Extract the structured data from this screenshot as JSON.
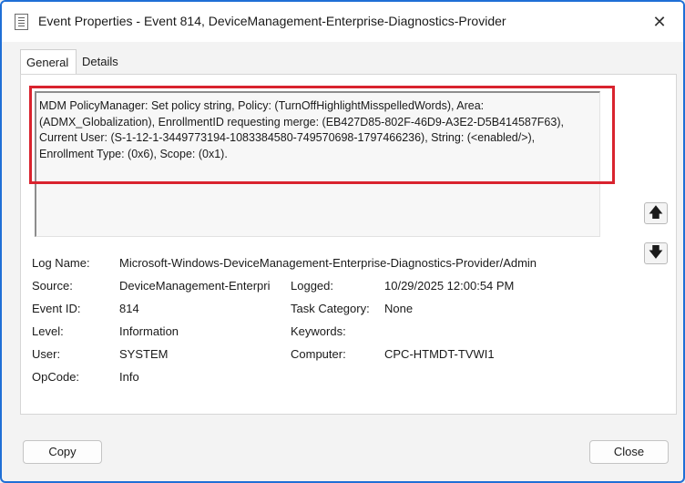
{
  "window": {
    "title": "Event Properties - Event 814, DeviceManagement-Enterprise-Diagnostics-Provider",
    "icon": "event-log-icon",
    "close_glyph": "✕"
  },
  "tabs": [
    {
      "label": "General",
      "active": true
    },
    {
      "label": "Details",
      "active": false
    }
  ],
  "message": "MDM PolicyManager: Set policy string, Policy: (TurnOffHighlightMisspelledWords), Area: (ADMX_Globalization), EnrollmentID requesting merge: (EB427D85-802F-46D9-A3E2-D5B414587F63), Current User: (S-1-12-1-3449773194-1083384580-749570698-1797466236), String: (<enabled/>), Enrollment Type: (0x6), Scope: (0x1).",
  "highlight_color": "#d9232e",
  "scroll": {
    "up_glyph": "🡅",
    "down_glyph": "🡇"
  },
  "fields": {
    "log_name": {
      "label": "Log Name:",
      "value": "Microsoft-Windows-DeviceManagement-Enterprise-Diagnostics-Provider/Admin"
    },
    "source": {
      "label": "Source:",
      "value": "DeviceManagement-Enterpri"
    },
    "logged": {
      "label": "Logged:",
      "value": "10/29/2025 12:00:54 PM"
    },
    "event_id": {
      "label": "Event ID:",
      "value": "814"
    },
    "task_category": {
      "label": "Task Category:",
      "value": "None"
    },
    "level": {
      "label": "Level:",
      "value": "Information"
    },
    "keywords": {
      "label": "Keywords:",
      "value": ""
    },
    "user": {
      "label": "User:",
      "value": "SYSTEM"
    },
    "computer": {
      "label": "Computer:",
      "value": "CPC-HTMDT-TVWI1"
    },
    "opcode": {
      "label": "OpCode:",
      "value": "Info"
    }
  },
  "buttons": {
    "copy": "Copy",
    "close": "Close"
  }
}
